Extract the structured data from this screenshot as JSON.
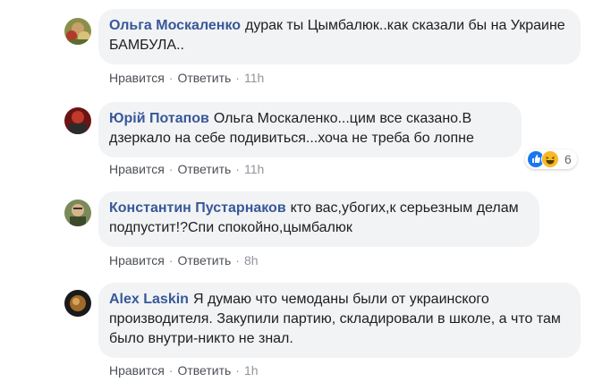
{
  "comments": [
    {
      "author": "Ольга Москаленко",
      "text": "дурак ты Цымбалюк..как сказали бы на Украине БАМБУЛА..",
      "like_label": "Нравится",
      "reply_label": "Ответить",
      "time": "11h"
    },
    {
      "author": "Юрій Потапов",
      "text": "Ольга Москаленко...цим все сказано.В дзеркало на себе подивиться...хоча не треба бо лопне",
      "like_label": "Нравится",
      "reply_label": "Ответить",
      "time": "11h",
      "reactions": {
        "icons": [
          "like-icon",
          "haha-icon"
        ],
        "count": "6"
      }
    },
    {
      "author": "Константин Пустарнаков",
      "text": "кто вас,убогих,к серьезным делам подпустит!?Спи спокойно,цымбалюк",
      "like_label": "Нравится",
      "reply_label": "Ответить",
      "time": "8h"
    },
    {
      "author": "Alex Laskin",
      "text": "Я думаю что чемоданы были от украинского производителя. Закупили партию, складировали в школе, а что там было внутри-никто не знал.",
      "like_label": "Нравится",
      "reply_label": "Ответить",
      "time": "1h"
    }
  ],
  "colors": {
    "author": "#385898",
    "bubble": "#f2f3f5",
    "meta": "#90949c",
    "like_reaction": "#1877f2",
    "haha_reaction": "#f7b928"
  }
}
